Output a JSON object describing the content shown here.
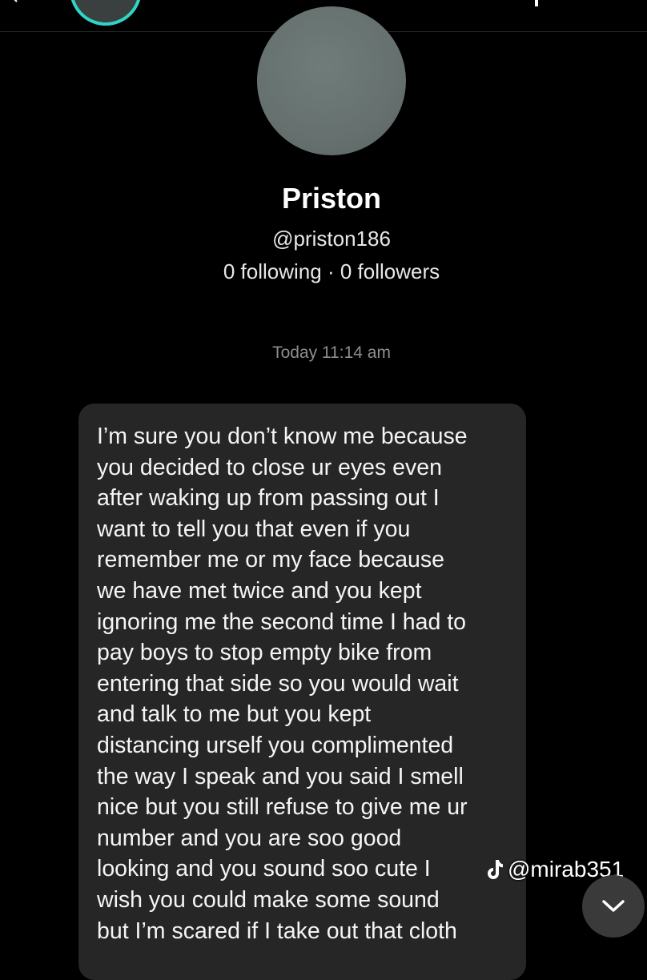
{
  "profile": {
    "name": "Priston",
    "handle": "@priston186",
    "stats": "0 following · 0 followers"
  },
  "conversation": {
    "timestamp": "Today 11:14 am",
    "message": "I’m sure you don’t know me because\nyou decided to close ur eyes even\nafter waking up from passing out I\nwant to tell you that even if you\nremember me or my face because\nwe have met twice and you kept\nignoring me the second time I had to\npay boys to stop empty bike from\nentering that side so you would wait\nand talk to me but you kept\ndistancing urself you complimented\nthe way I speak and you said I smell\nnice but you still refuse to give me ur\nnumber and you are soo good\nlooking and you sound soo cute I\nwish you could make some sound\nbut I’m scared if I take out that cloth"
  },
  "watermark": {
    "icon": "tiktok-icon",
    "handle": "@mirab351"
  },
  "icons": {
    "back": "chevron-left-icon",
    "scroll_down": "chevron-down-icon"
  },
  "colors": {
    "background": "#000000",
    "bubble": "#262626",
    "story_ring": "#2fd3c7",
    "timestamp": "#8e8e8e"
  }
}
